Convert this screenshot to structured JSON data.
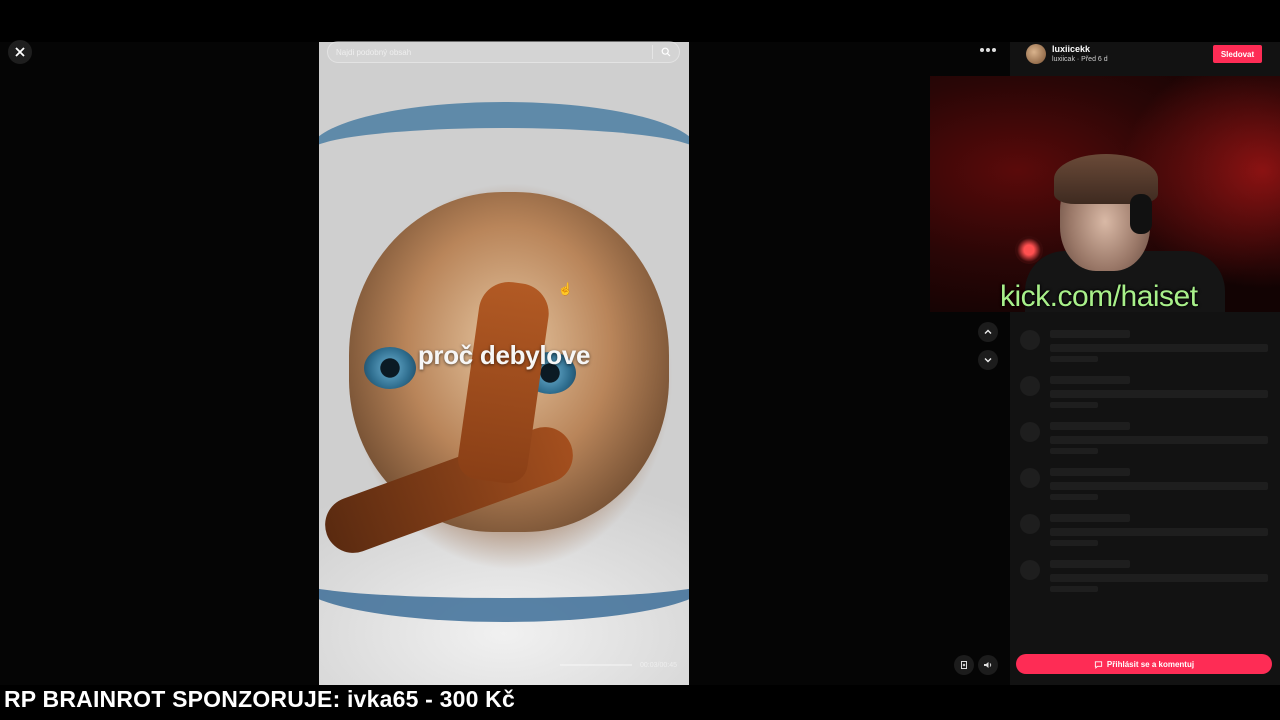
{
  "search": {
    "placeholder": "Najdi podobný obsah"
  },
  "video": {
    "caption": "proč debylove",
    "timecode": "00:03/00:45",
    "progress": 0.07
  },
  "author": {
    "name": "luxiicekk",
    "meta": "luxiicak · Před 6 d"
  },
  "buttons": {
    "follow": "Sledovat",
    "comment": "Přihlásit se a komentuj"
  },
  "webcam": {
    "url": "kick.com/haiset"
  },
  "ticker": {
    "text": "RP BRAINROT SPONZORUJE: ivka65 - 300 Kč"
  },
  "icons": {
    "close": "close-icon",
    "search": "search-icon",
    "more": "more-icon",
    "up": "chevron-up-icon",
    "down": "chevron-down-icon",
    "report": "report-icon",
    "volume": "volume-icon",
    "comment": "comment-icon"
  },
  "colors": {
    "accent": "#fe2c55",
    "webcam_text": "#a8f08a",
    "panel_bg": "#121212"
  }
}
